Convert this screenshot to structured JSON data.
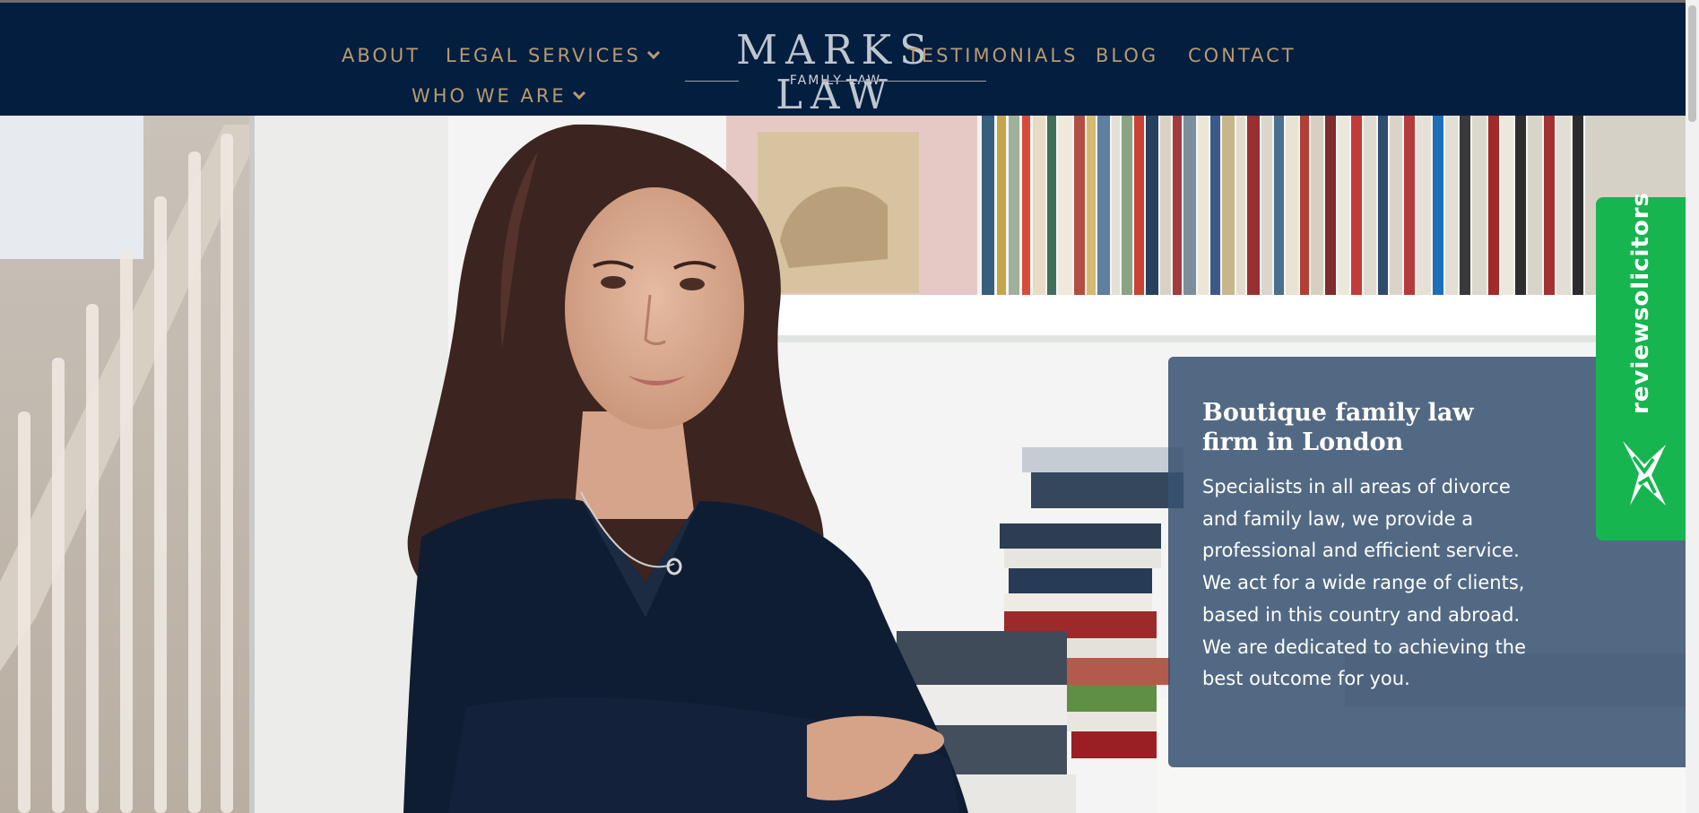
{
  "nav": {
    "about": "ABOUT",
    "legal_services": "LEGAL SERVICES",
    "who_we_are": "WHO WE ARE",
    "testimonials": "TESTIMONIALS",
    "blog": "BLOG",
    "contact": "CONTACT"
  },
  "logo": {
    "name": "MARKS LAW",
    "tagline": "FAMILY LAW"
  },
  "hero": {
    "title": "Boutique family law firm in London",
    "body": "Specialists in all areas of divorce and family law, we provide a professional and efficient service. We act for a wide range of clients, based in this country and abroad. We are dedicated to achieving the best outcome for you."
  },
  "badge": {
    "text": "reviewsolicitors",
    "icon": "reviewsolicitors-logo-icon"
  },
  "colors": {
    "header_bg": "#031e3f",
    "nav_gold": "#b99b70",
    "info_box": "#375170",
    "badge_green": "#16b550"
  }
}
